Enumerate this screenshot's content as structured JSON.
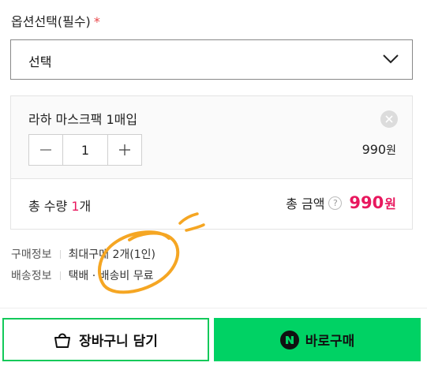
{
  "option": {
    "label": "옵션선택(필수)",
    "required_mark": "*",
    "select_value": "선택"
  },
  "item": {
    "name": "라하 마스크팩 1매입",
    "quantity": "1",
    "price": "990",
    "price_unit": "원"
  },
  "summary": {
    "qty_label": "총 수량",
    "qty_value": "1",
    "qty_unit": "개",
    "amount_label": "총 금액",
    "help_glyph": "?",
    "amount_value": "990",
    "amount_unit": "원"
  },
  "info": [
    {
      "key": "구매정보",
      "value": "최대구매 2개(1인)"
    },
    {
      "key": "배송정보",
      "value": "택배 · 배송비 무료"
    }
  ],
  "actions": {
    "cart_label": "장바구니 담기",
    "buy_label": "바로구매",
    "buy_badge": "N"
  },
  "colors": {
    "accent_pink": "#e8185e",
    "naver_green": "#00d264",
    "scribble_orange": "#f5a623"
  },
  "icons": {
    "select": "chevron-down-icon",
    "remove": "close-icon",
    "minus": "minus-icon",
    "plus": "plus-icon",
    "help": "question-icon",
    "cart": "shopping-bag-icon",
    "buy": "naver-n-icon"
  }
}
